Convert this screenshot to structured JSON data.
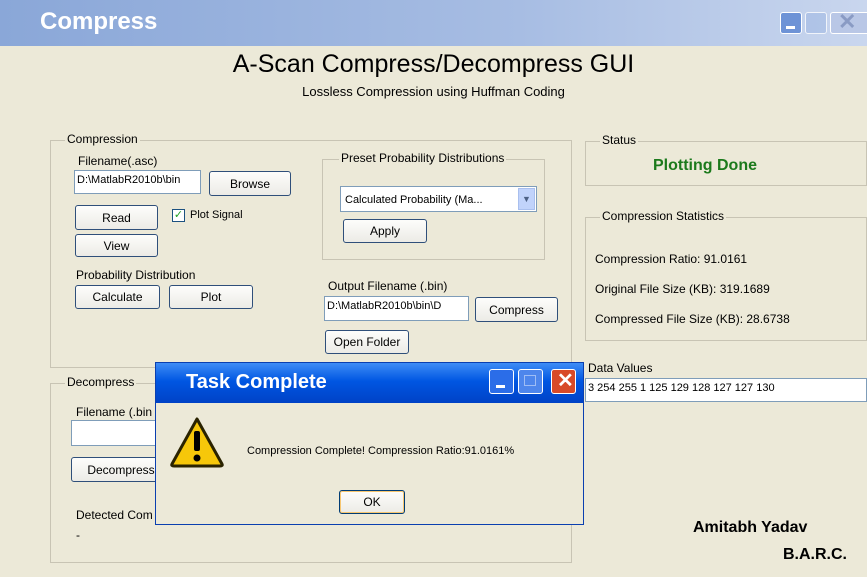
{
  "window": {
    "title": "Compress"
  },
  "header": {
    "title": "A-Scan Compress/Decompress GUI",
    "subtitle": "Lossless Compression using Huffman Coding"
  },
  "compression": {
    "legend": "Compression",
    "filename_label": "Filename(.asc)",
    "filename_value": "D:\\MatlabR2010b\\bin",
    "browse_label": "Browse",
    "read_label": "Read",
    "plot_signal_label": "Plot Signal",
    "plot_signal_checked": true,
    "view_label": "View",
    "prob_dist_label": "Probability Distribution",
    "calculate_label": "Calculate",
    "plot_label": "Plot",
    "preset": {
      "legend": "Preset Probability Distributions",
      "selected": "Calculated Probability (Ma...",
      "apply_label": "Apply"
    },
    "output_label": "Output Filename (.bin)",
    "output_value": "D:\\MatlabR2010b\\bin\\D",
    "compress_label": "Compress",
    "open_folder_label": "Open Folder"
  },
  "decompress": {
    "legend": "Decompress",
    "filename_label": "Filename (.bin",
    "filename_value": "",
    "decompress_label": "Decompress",
    "detected_label": "Detected Com",
    "detected_value": "-"
  },
  "status": {
    "legend": "Status",
    "text": "Plotting Done",
    "color": "#1c7a1c"
  },
  "stats": {
    "legend": "Compression Statistics",
    "ratio": "Compression Ratio: 91.0161",
    "original": "Original File Size (KB):  319.1689",
    "compressed": "Compressed File Size (KB): 28.6738"
  },
  "data_values": {
    "label": "Data Values",
    "value": "3  254  255    1  125  129  128  127  127  130"
  },
  "footer": {
    "author": "Amitabh Yadav",
    "org": "B.A.R.C."
  },
  "dialog": {
    "title": "Task Complete",
    "icon": "warning-icon",
    "message": "Compression Complete! Compression Ratio:91.0161%",
    "ok_label": "OK",
    "close_symbol": "✕"
  }
}
